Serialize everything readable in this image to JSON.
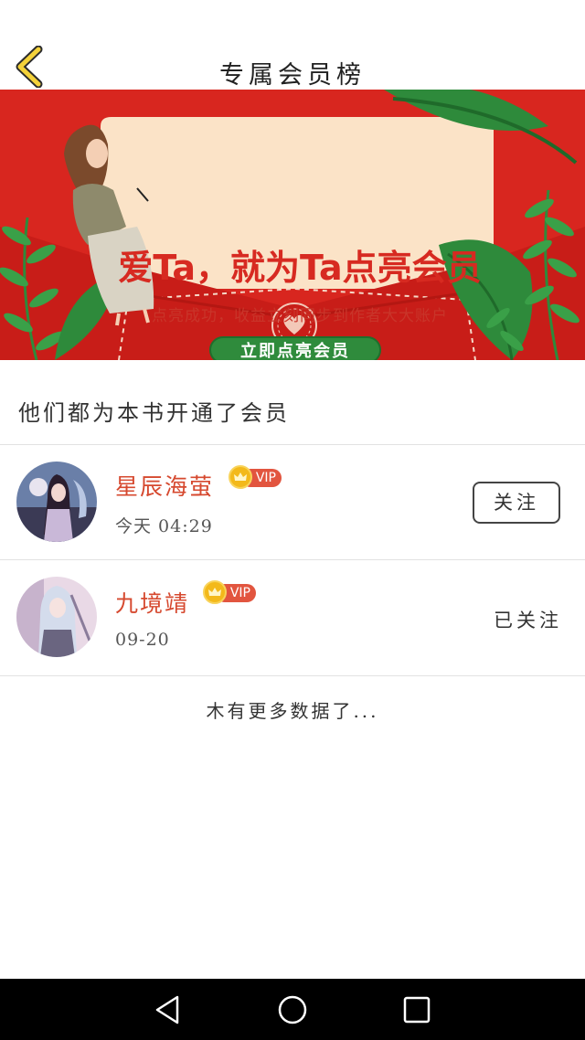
{
  "header": {
    "title": "专属会员榜"
  },
  "banner": {
    "title": "爱Ta，就为Ta点亮会员",
    "subtitle": "点亮成功，收益立刻同步到作者大大账户",
    "cta": "立即点亮会员",
    "colors": {
      "red": "#d8261f",
      "cream": "#fbe3c7",
      "green": "#2f8b3c"
    }
  },
  "list": {
    "heading": "他们都为本书开通了会员",
    "members": [
      {
        "name": "星辰海萤",
        "badge": "VIP",
        "time": "今天 04:29",
        "action": "关注"
      },
      {
        "name": "九境靖",
        "badge": "VIP",
        "time": "09-20",
        "action": "已关注"
      }
    ],
    "footer": "木有更多数据了..."
  },
  "system_nav": {
    "icons": [
      "back-triangle-icon",
      "home-circle-icon",
      "recents-square-icon"
    ]
  }
}
